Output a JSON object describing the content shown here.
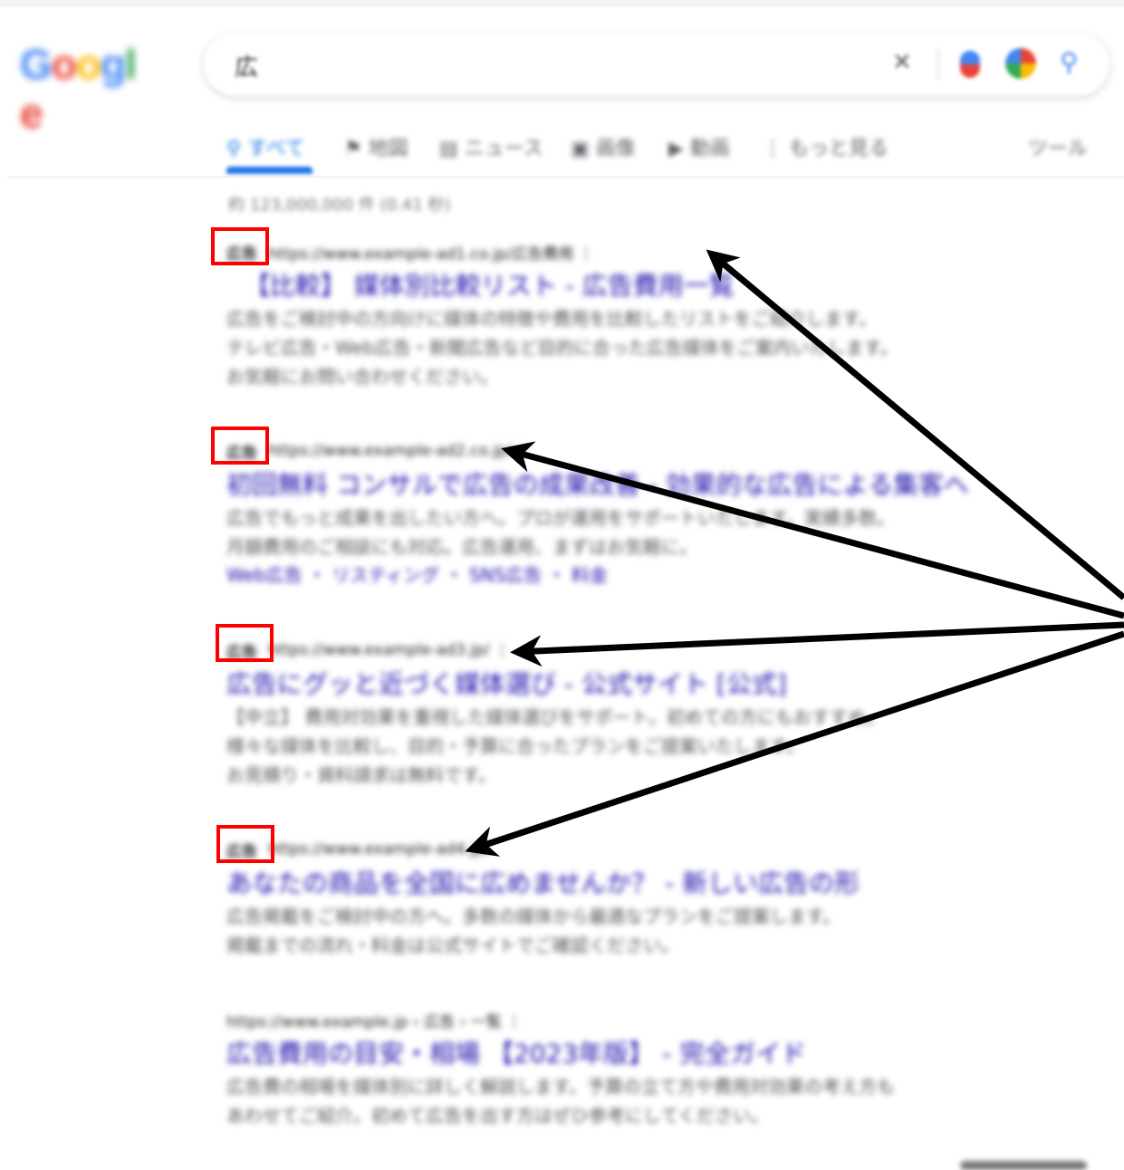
{
  "logo": {
    "text": "Google",
    "colors": [
      "#4285f4",
      "#ea4335",
      "#fbbc05",
      "#4285f4",
      "#34a853",
      "#ea4335"
    ]
  },
  "search": {
    "query": "広",
    "icons": [
      "clear-icon",
      "microphone-icon",
      "lens-icon",
      "search-icon"
    ]
  },
  "tabs": [
    {
      "label": "すべて",
      "icon": "search-icon"
    },
    {
      "label": "地図",
      "icon": "map-pin-icon"
    },
    {
      "label": "ニュース",
      "icon": "news-icon"
    },
    {
      "label": "画像",
      "icon": "image-icon"
    },
    {
      "label": "動画",
      "icon": "video-icon"
    },
    {
      "label": "もっと見る",
      "icon": "more-icon"
    },
    {
      "label": "ツール",
      "icon": ""
    }
  ],
  "stats": "約 123,000,000 件 (0.41 秒)",
  "results": [
    {
      "badge": "広告",
      "url": "https://www.example-ad1.co.jp/広告費用 ⋮",
      "title": "【比較】 媒体別比較リスト - 広告費用一覧",
      "snippet": [
        "広告をご検討中の方向けに媒体の特徴や費用を比較したリストをご紹介します。",
        "テレビ広告・Web広告・新聞広告など目的に合った広告媒体をご案内いたします。",
        "お気軽にお問い合わせください。"
      ],
      "links": ""
    },
    {
      "badge": "広告",
      "url": "https://www.example-ad2.co.jp/ ⋮",
      "title": "初回無料 コンサルで広告の成果改善 - 効果的な広告による集客へ",
      "snippet": [
        "広告でもっと成果を出したい方へ。プロが運用をサポートいたします。実績多数。",
        "月額費用のご相談にも対応。広告運用、まずはお気軽に。"
      ],
      "links": "Web広告 ・ リスティング ・ SNS広告 ・ 料金"
    },
    {
      "badge": "広告",
      "url": "https://www.example-ad3.jp/ ⋮",
      "title": "広告にグッと近づく媒体選び - 公式サイト [公式]",
      "snippet": [
        "【中立】 費用対効果を重視した媒体選びをサポート。初めての方にもおすすめ。",
        "様々な媒体を比較し、目的・予算に合ったプランをご提案いたします。",
        "お見積り・資料請求は無料です。"
      ],
      "links": ""
    },
    {
      "badge": "広告",
      "url": "https://www.example-ad4.jp/",
      "title": "あなたの商品を全国に広めませんか？ - 新しい広告の形",
      "snippet": [
        "広告掲載をご検討中の方へ。多数の媒体から最適なプランをご提案します。",
        "掲載までの流れ・料金は公式サイトでご確認ください。"
      ],
      "links": ""
    },
    {
      "badge": "",
      "url": "https://www.example.jp › 広告 › 一覧 ⋮",
      "title": "広告費用の目安・相場 【2023年版】 - 完全ガイド",
      "snippet": [
        "広告費の相場を媒体別に詳しく解説します。予算の立て方や費用対効果の考え方も",
        "あわせてご紹介。初めて広告を出す方はぜひ参考にしてください。"
      ],
      "links": ""
    }
  ]
}
